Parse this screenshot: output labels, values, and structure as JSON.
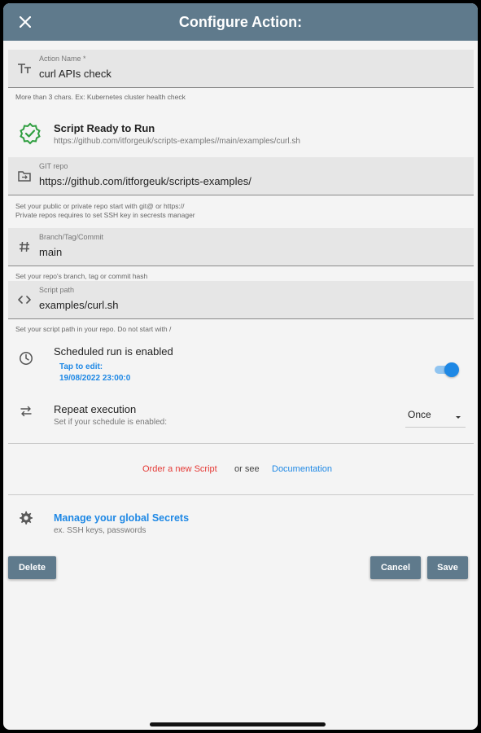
{
  "appbar": {
    "title": "Configure Action:"
  },
  "action_name": {
    "label": "Action Name *",
    "value": "curl APIs check",
    "helper": "More than 3 chars. Ex: Kubernetes cluster health check"
  },
  "script_status": {
    "title": "Script Ready to Run",
    "url": "https://github.com/itforgeuk/scripts-examples//main/examples/curl.sh"
  },
  "git_repo": {
    "label": "GIT repo",
    "value": "https://github.com/itforgeuk/scripts-examples/",
    "helper_line1": "Set your public or private repo start with git@ or https://",
    "helper_line2": "Private repos requires to set SSH key in secrests manager"
  },
  "branch": {
    "label": "Branch/Tag/Commit",
    "value": "main",
    "helper": "Set your repo's  branch, tag or commit hash"
  },
  "script_path": {
    "label": "Script path",
    "value": "examples/curl.sh",
    "helper": "Set your script path in your repo. Do not start with /"
  },
  "schedule": {
    "title": "Scheduled run is enabled",
    "tap_to_edit": "Tap to edit:",
    "datetime": "19/08/2022 23:00:0",
    "enabled": true
  },
  "repeat": {
    "title": "Repeat execution",
    "subtitle": "Set if your schedule is enabled:",
    "selected": "Once"
  },
  "links": {
    "order": "Order a new Script",
    "or_see": "or see",
    "docs": "Documentation"
  },
  "secrets": {
    "title": "Manage your global Secrets",
    "subtitle": "ex. SSH keys, passwords"
  },
  "buttons": {
    "delete": "Delete",
    "cancel": "Cancel",
    "save": "Save"
  },
  "colors": {
    "appbar": "#5f7a8c",
    "accent_blue": "#1e88e5",
    "link_red": "#e53935",
    "check_green": "#2e9e3f",
    "background": "#f4f4f4"
  }
}
